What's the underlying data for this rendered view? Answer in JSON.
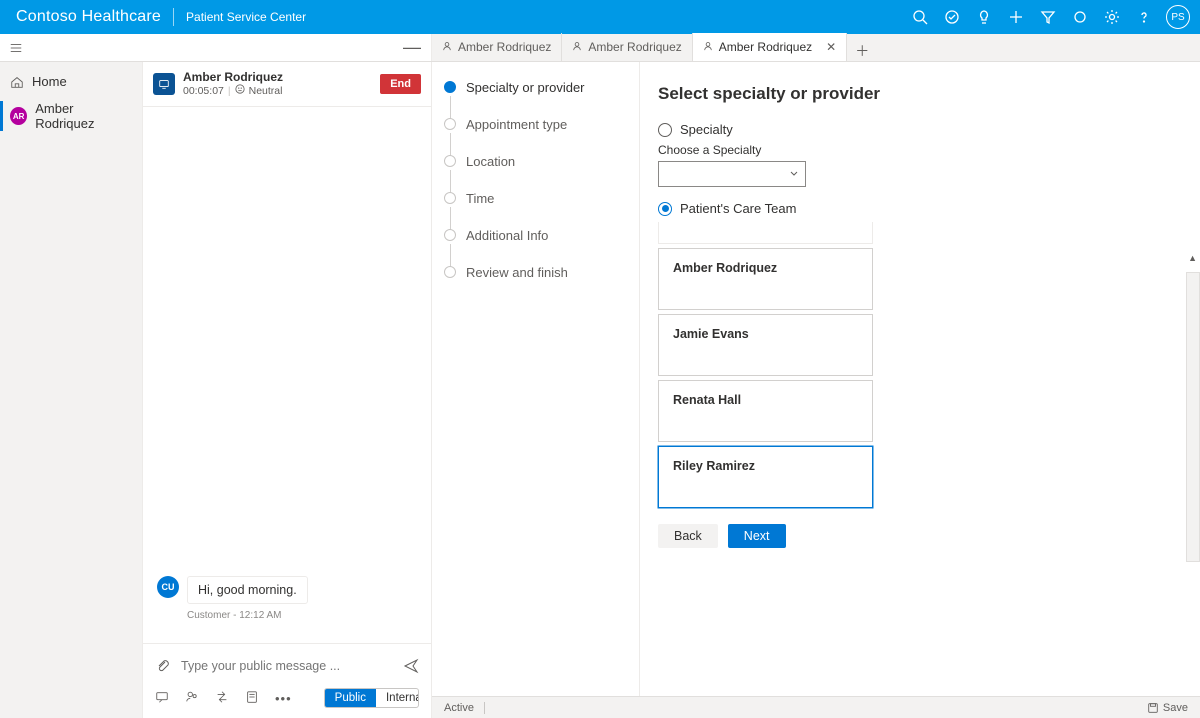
{
  "topbar": {
    "brand": "Contoso Healthcare",
    "subtitle": "Patient Service Center",
    "avatar_initials": "PS"
  },
  "sidebar": {
    "home": "Home",
    "contact_name": "Amber Rodriquez",
    "contact_initials": "AR"
  },
  "tabs": [
    {
      "label": "Amber Rodriquez",
      "active": false,
      "closable": false
    },
    {
      "label": "Amber Rodriquez",
      "active": false,
      "closable": false
    },
    {
      "label": "Amber Rodriquez",
      "active": true,
      "closable": true
    }
  ],
  "chat": {
    "name": "Amber Rodriquez",
    "elapsed": "00:05:07",
    "sentiment": "Neutral",
    "end_label": "End",
    "message_avatar": "CU",
    "message_text": "Hi, good morning.",
    "message_meta": "Customer - 12:12 AM",
    "input_placeholder": "Type your public message ...",
    "toggle_public": "Public",
    "toggle_internal": "Internal"
  },
  "wizard": {
    "steps": [
      "Specialty or provider",
      "Appointment type",
      "Location",
      "Time",
      "Additional Info",
      "Review and finish"
    ],
    "active_index": 0
  },
  "form": {
    "title": "Select specialty or provider",
    "radio_specialty": "Specialty",
    "choose_specialty_label": "Choose a Specialty",
    "radio_careteam": "Patient's Care Team",
    "care_team": [
      "Amber Rodriquez",
      "Jamie Evans",
      "Renata Hall",
      "Riley Ramirez"
    ],
    "selected_care_index": 3,
    "back_label": "Back",
    "next_label": "Next"
  },
  "statusbar": {
    "status": "Active",
    "save": "Save"
  }
}
